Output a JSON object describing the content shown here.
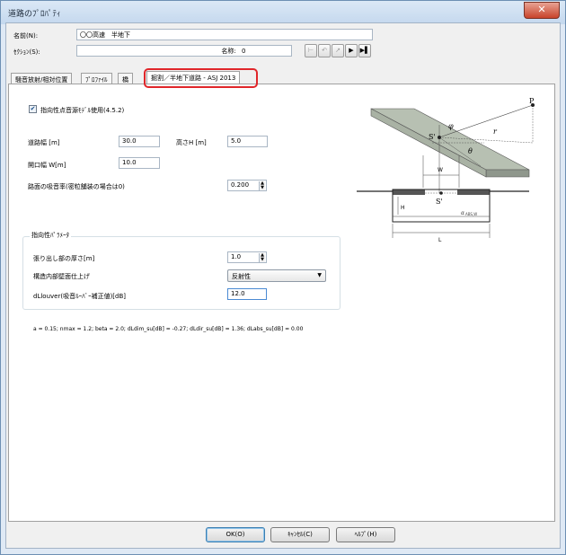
{
  "window": {
    "title": "道路のﾌﾟﾛﾊﾟﾃｨ",
    "close_glyph": "✕"
  },
  "fields": {
    "name_label": "名前(N):",
    "name_value": "〇〇高速　半地下",
    "section_label": "ｾｸｼｮﾝ(S):",
    "section_name_label": "名称:",
    "section_name_value": "0"
  },
  "nav_buttons": [
    "⊢",
    "↶",
    "↗",
    "▶",
    "▶▌"
  ],
  "tabs": [
    {
      "label": "騒音放射/相対位置"
    },
    {
      "label": "ﾌﾟﾛﾌｧｲﾙ"
    },
    {
      "label": "橋"
    },
    {
      "label": "掘割／半地下道路 - ASJ 2013"
    }
  ],
  "panel": {
    "directivity_check_label": "指向性点音源ﾓﾃﾞﾙ使用(4.5.2)",
    "directivity_checked": true,
    "road_width_label": "道路幅 [m]",
    "road_width_value": "30.0",
    "height_label": "高さH [m]",
    "height_value": "5.0",
    "opening_width_label": "開口幅 W[m]",
    "opening_width_value": "10.0",
    "absorption_label": "路面の吸音率(密粒舗装の場合は0)",
    "absorption_value": "0.200",
    "group_title": "指向性ﾊﾟﾗﾒｰﾀ",
    "overhang_label": "張り出し部の厚さ[m]",
    "overhang_value": "1.0",
    "finish_label": "構造内部壁面仕上げ",
    "finish_value": "反射性",
    "dlouver_label": "dLlouver(吸音ﾙｰﾊﾞｰ補正値)[dB]",
    "dlouver_value": "12.0",
    "result_text": "a = 0.15; nmax = 1.2; beta = 2.0; dLdim_su[dB] = -0.27; dLdir_su[dB] = 1.36; dLabs_su[dB] = 0.00"
  },
  "diagram": {
    "label_P": "P",
    "label_phi": "φ",
    "label_r": "r",
    "label_S_top": "S'",
    "label_theta": "θ",
    "label_W": "W",
    "label_S_bottom": "S'",
    "label_H": "H",
    "label_alpha": "α",
    "label_alpha_sub": "ABS,W",
    "label_L": "L"
  },
  "buttons": {
    "ok": "OK(O)",
    "cancel": "ｷｬﾝｾﾙ(C)",
    "help": "ﾍﾙﾌﾟ(H)"
  }
}
